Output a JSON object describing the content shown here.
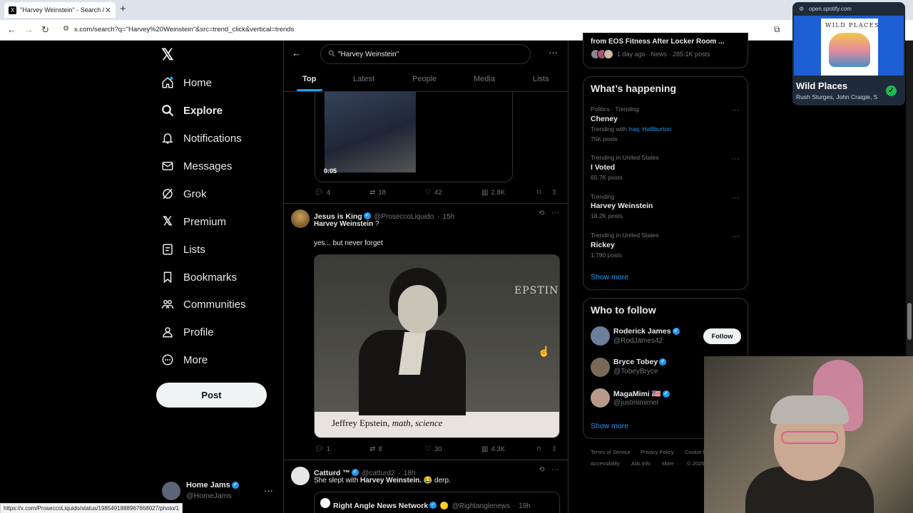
{
  "browser": {
    "tab_title": "\"Harvey Weinstein\" - Search / X",
    "tab_close": "✕",
    "new_tab": "+",
    "url": "x.com/search?q=\"Harvey%20Weinstein\"&src=trend_click&vertical=trends",
    "status_url": "https://x.com/ProseccoLiquido/status/1985491888967668027/photo/1"
  },
  "nav": {
    "logo": "𝕏",
    "items": [
      {
        "label": "Home",
        "icon": "home-icon"
      },
      {
        "label": "Explore",
        "icon": "search-icon"
      },
      {
        "label": "Notifications",
        "icon": "bell-icon"
      },
      {
        "label": "Messages",
        "icon": "mail-icon"
      },
      {
        "label": "Grok",
        "icon": "grok-icon"
      },
      {
        "label": "Premium",
        "icon": "x-premium-icon"
      },
      {
        "label": "Lists",
        "icon": "lists-icon"
      },
      {
        "label": "Bookmarks",
        "icon": "bookmark-icon"
      },
      {
        "label": "Communities",
        "icon": "communities-icon"
      },
      {
        "label": "Profile",
        "icon": "person-icon"
      },
      {
        "label": "More",
        "icon": "more-circle-icon"
      }
    ],
    "post_label": "Post",
    "account": {
      "name": "Home Jams",
      "handle": "@HomeJams"
    }
  },
  "search": {
    "query": "\"Harvey Weinstein\"",
    "tabs": [
      "Top",
      "Latest",
      "People",
      "Media",
      "Lists"
    ]
  },
  "feed": {
    "video": {
      "duration": "0:05",
      "replies": "4",
      "reposts": "18",
      "likes": "42",
      "views": "2.8K"
    },
    "post1": {
      "name": "Jesus is King",
      "handle": "@ProseccoLiquido",
      "time": "15h",
      "line1": "Harvey Weinstein",
      "line1_suffix": " ?",
      "line2": "yes... but never forget",
      "photo_caption_name": "Jeffrey Epstein,",
      "photo_caption_subj": "math, science",
      "chalk_text": "EPSTIN",
      "replies": "1",
      "reposts": "8",
      "likes": "30",
      "views": "4.3K"
    },
    "post2": {
      "name": "Catturd ™",
      "handle": "@catturd2",
      "time": "18h",
      "text_pre": "She slept with ",
      "text_bold": "Harvey Weinstein.",
      "text_emoji": " 😂 ",
      "text_post": "derp.",
      "quote_name": "Right Angle News Network",
      "quote_emoji": "🟡",
      "quote_handle": "@Rightanglenews",
      "quote_time": "19h"
    }
  },
  "sidebar": {
    "news": {
      "title": "from EOS Fitness After Locker Room ...",
      "meta": "1 day ago · News · 285.1K posts"
    },
    "happening": {
      "title": "What’s happening",
      "trends": [
        {
          "label": "Politics · Trending",
          "title": "Cheney",
          "with_prefix": "Trending with ",
          "with_links": "Iraq, Halliburton",
          "posts": "75K posts"
        },
        {
          "label": "Trending in United States",
          "title": "I Voted",
          "posts": "65.7K posts"
        },
        {
          "label": "Trending",
          "title": "Harvey Weinstein",
          "posts": "18.2K posts"
        },
        {
          "label": "Trending in United States",
          "title": "Rickey",
          "posts": "1,780 posts"
        }
      ],
      "show_more": "Show more"
    },
    "follow": {
      "title": "Who to follow",
      "follow_label": "Follow",
      "people": [
        {
          "name": "Roderick James",
          "handle": "@RodJames42"
        },
        {
          "name": "Bryce Tobey",
          "handle": "@TobeyBryce"
        },
        {
          "name": "MagaMimi 🇺🇸",
          "handle": "@justmimimel"
        }
      ],
      "show_more": "Show more"
    },
    "footer": {
      "links": [
        "Terms of Service",
        "Privacy Policy",
        "Cookie P",
        "Accessibility",
        "Ads info",
        "More ···",
        "© 2025"
      ]
    }
  },
  "spotify": {
    "host": "open.spotify.com",
    "art_title": "WILD PLACES",
    "title": "Wild Places",
    "artists": "Rush Sturges, John Craigie, St",
    "check": "✓"
  }
}
